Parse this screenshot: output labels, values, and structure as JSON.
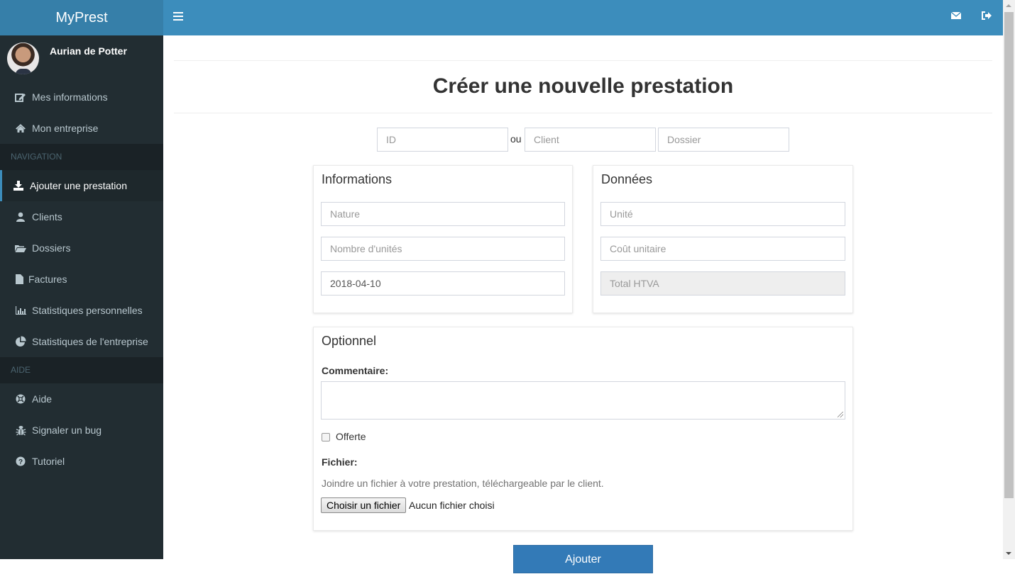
{
  "app": {
    "title": "MyPrest"
  },
  "topbar": {
    "menu_toggle_icon": "bars-icon",
    "icons": [
      "envelope-icon",
      "sign-out-icon"
    ]
  },
  "user": {
    "name": "Aurian de Potter"
  },
  "sidebar": {
    "account_items": [
      {
        "label": "Mes informations",
        "icon": "edit-icon"
      },
      {
        "label": "Mon entreprise",
        "icon": "home-icon"
      }
    ],
    "nav_header": "NAVIGATION",
    "nav_items": [
      {
        "label": "Ajouter une prestation",
        "icon": "download-icon",
        "active": true
      },
      {
        "label": "Clients",
        "icon": "user-icon"
      },
      {
        "label": "Dossiers",
        "icon": "folder-open-icon"
      },
      {
        "label": "Factures",
        "icon": "file-icon"
      },
      {
        "label": "Statistiques personnelles",
        "icon": "bar-chart-icon"
      },
      {
        "label": "Statistiques de l'entreprise",
        "icon": "pie-chart-icon"
      }
    ],
    "help_header": "AIDE",
    "help_items": [
      {
        "label": "Aide",
        "icon": "life-ring-icon"
      },
      {
        "label": "Signaler un bug",
        "icon": "bug-icon"
      },
      {
        "label": "Tutoriel",
        "icon": "question-circle-icon"
      }
    ]
  },
  "page": {
    "title": "Créer une nouvelle prestation",
    "search": {
      "id_placeholder": "ID",
      "or_label": "ou",
      "client_placeholder": "Client",
      "dossier_placeholder": "Dossier"
    },
    "informations": {
      "title": "Informations",
      "nature_placeholder": "Nature",
      "units_placeholder": "Nombre d'unités",
      "date_value": "2018-04-10"
    },
    "donnees": {
      "title": "Données",
      "unit_placeholder": "Unité",
      "unit_cost_placeholder": "Coût unitaire",
      "total_placeholder": "Total HTVA"
    },
    "optionnel": {
      "title": "Optionnel",
      "comment_label": "Commentaire:",
      "comment_value": "",
      "offered_label": "Offerte",
      "offered_checked": false,
      "file_label": "Fichier:",
      "file_help": "Joindre un fichier à votre prestation, téléchargeable par le client.",
      "file_button": "Choisir un fichier",
      "file_status": "Aucun fichier choisi"
    },
    "submit_label": "Ajouter"
  },
  "colors": {
    "brand": "#3c8dbc",
    "brand_dark": "#367fa9",
    "sidebar_bg": "#222d32",
    "primary_button": "#337ab7"
  }
}
